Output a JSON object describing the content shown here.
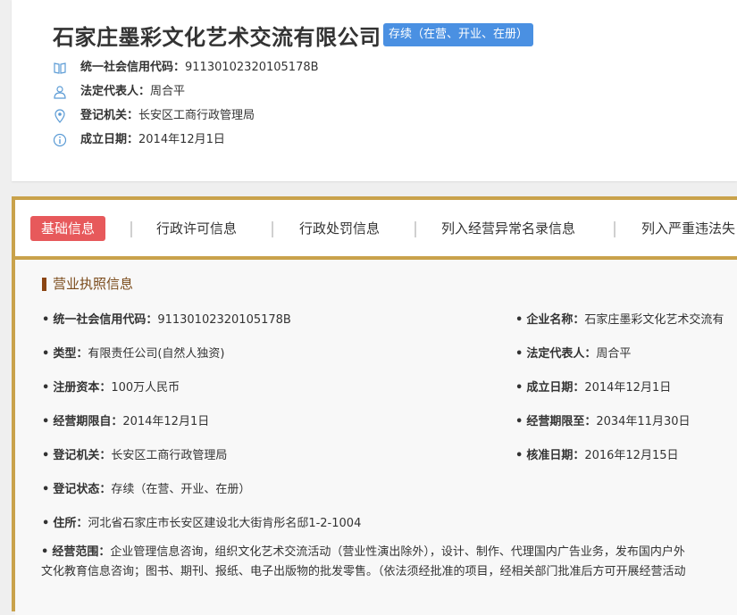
{
  "header": {
    "company_name": "石家庄墨彩文化艺术交流有限公司",
    "status_badge": "存续（在营、开业、在册）",
    "rows": [
      {
        "icon": "book-icon",
        "label": "统一社会信用代码：",
        "value": "91130102320105178B"
      },
      {
        "icon": "person-icon",
        "label": "法定代表人：",
        "value": "周合平"
      },
      {
        "icon": "location-pin-icon",
        "label": "登记机关：",
        "value": "长安区工商行政管理局"
      },
      {
        "icon": "info-circle-icon",
        "label": "成立日期：",
        "value": "2014年12月1日"
      }
    ]
  },
  "tabs": [
    {
      "label": "基础信息",
      "active": true
    },
    {
      "label": "行政许可信息",
      "active": false
    },
    {
      "label": "行政处罚信息",
      "active": false
    },
    {
      "label": "列入经营异常名录信息",
      "active": false
    },
    {
      "label": "列入严重违法失",
      "active": false
    }
  ],
  "section": {
    "title": "营业执照信息",
    "fields_left": [
      {
        "label": "统一社会信用代码：",
        "value": "91130102320105178B"
      },
      {
        "label": "类型：",
        "value": "有限责任公司(自然人独资)"
      },
      {
        "label": "注册资本：",
        "value": "100万人民币"
      },
      {
        "label": "经营期限自：",
        "value": "2014年12月1日"
      },
      {
        "label": "登记机关：",
        "value": "长安区工商行政管理局"
      },
      {
        "label": "登记状态：",
        "value": "存续（在营、开业、在册）"
      },
      {
        "label": "住所：",
        "value": "河北省石家庄市长安区建设北大街肯彤名邸1-2-1004"
      }
    ],
    "fields_right": [
      {
        "label": "企业名称：",
        "value": "石家庄墨彩文化艺术交流有"
      },
      {
        "label": "法定代表人：",
        "value": "周合平"
      },
      {
        "label": "成立日期：",
        "value": "2014年12月1日"
      },
      {
        "label": "经营期限至：",
        "value": "2034年11月30日"
      },
      {
        "label": "核准日期：",
        "value": "2016年12月15日"
      }
    ],
    "scope": {
      "label": "经营范围：",
      "line1": "企业管理信息咨询，组织文化艺术交流活动（营业性演出除外），设计、制作、代理国内广告业务，发布国内户外",
      "line2": "文化教育信息咨询；图书、期刊、报纸、电子出版物的批发零售。（依法须经批准的项目，经相关部门批准后方可开展经营活动"
    }
  },
  "colors": {
    "accent_gold": "#c9a24b",
    "badge_blue": "#4a90e2",
    "tab_active_red": "#e7595b",
    "icon_blue": "#5b9bd5",
    "section_brown": "#8b4513"
  }
}
